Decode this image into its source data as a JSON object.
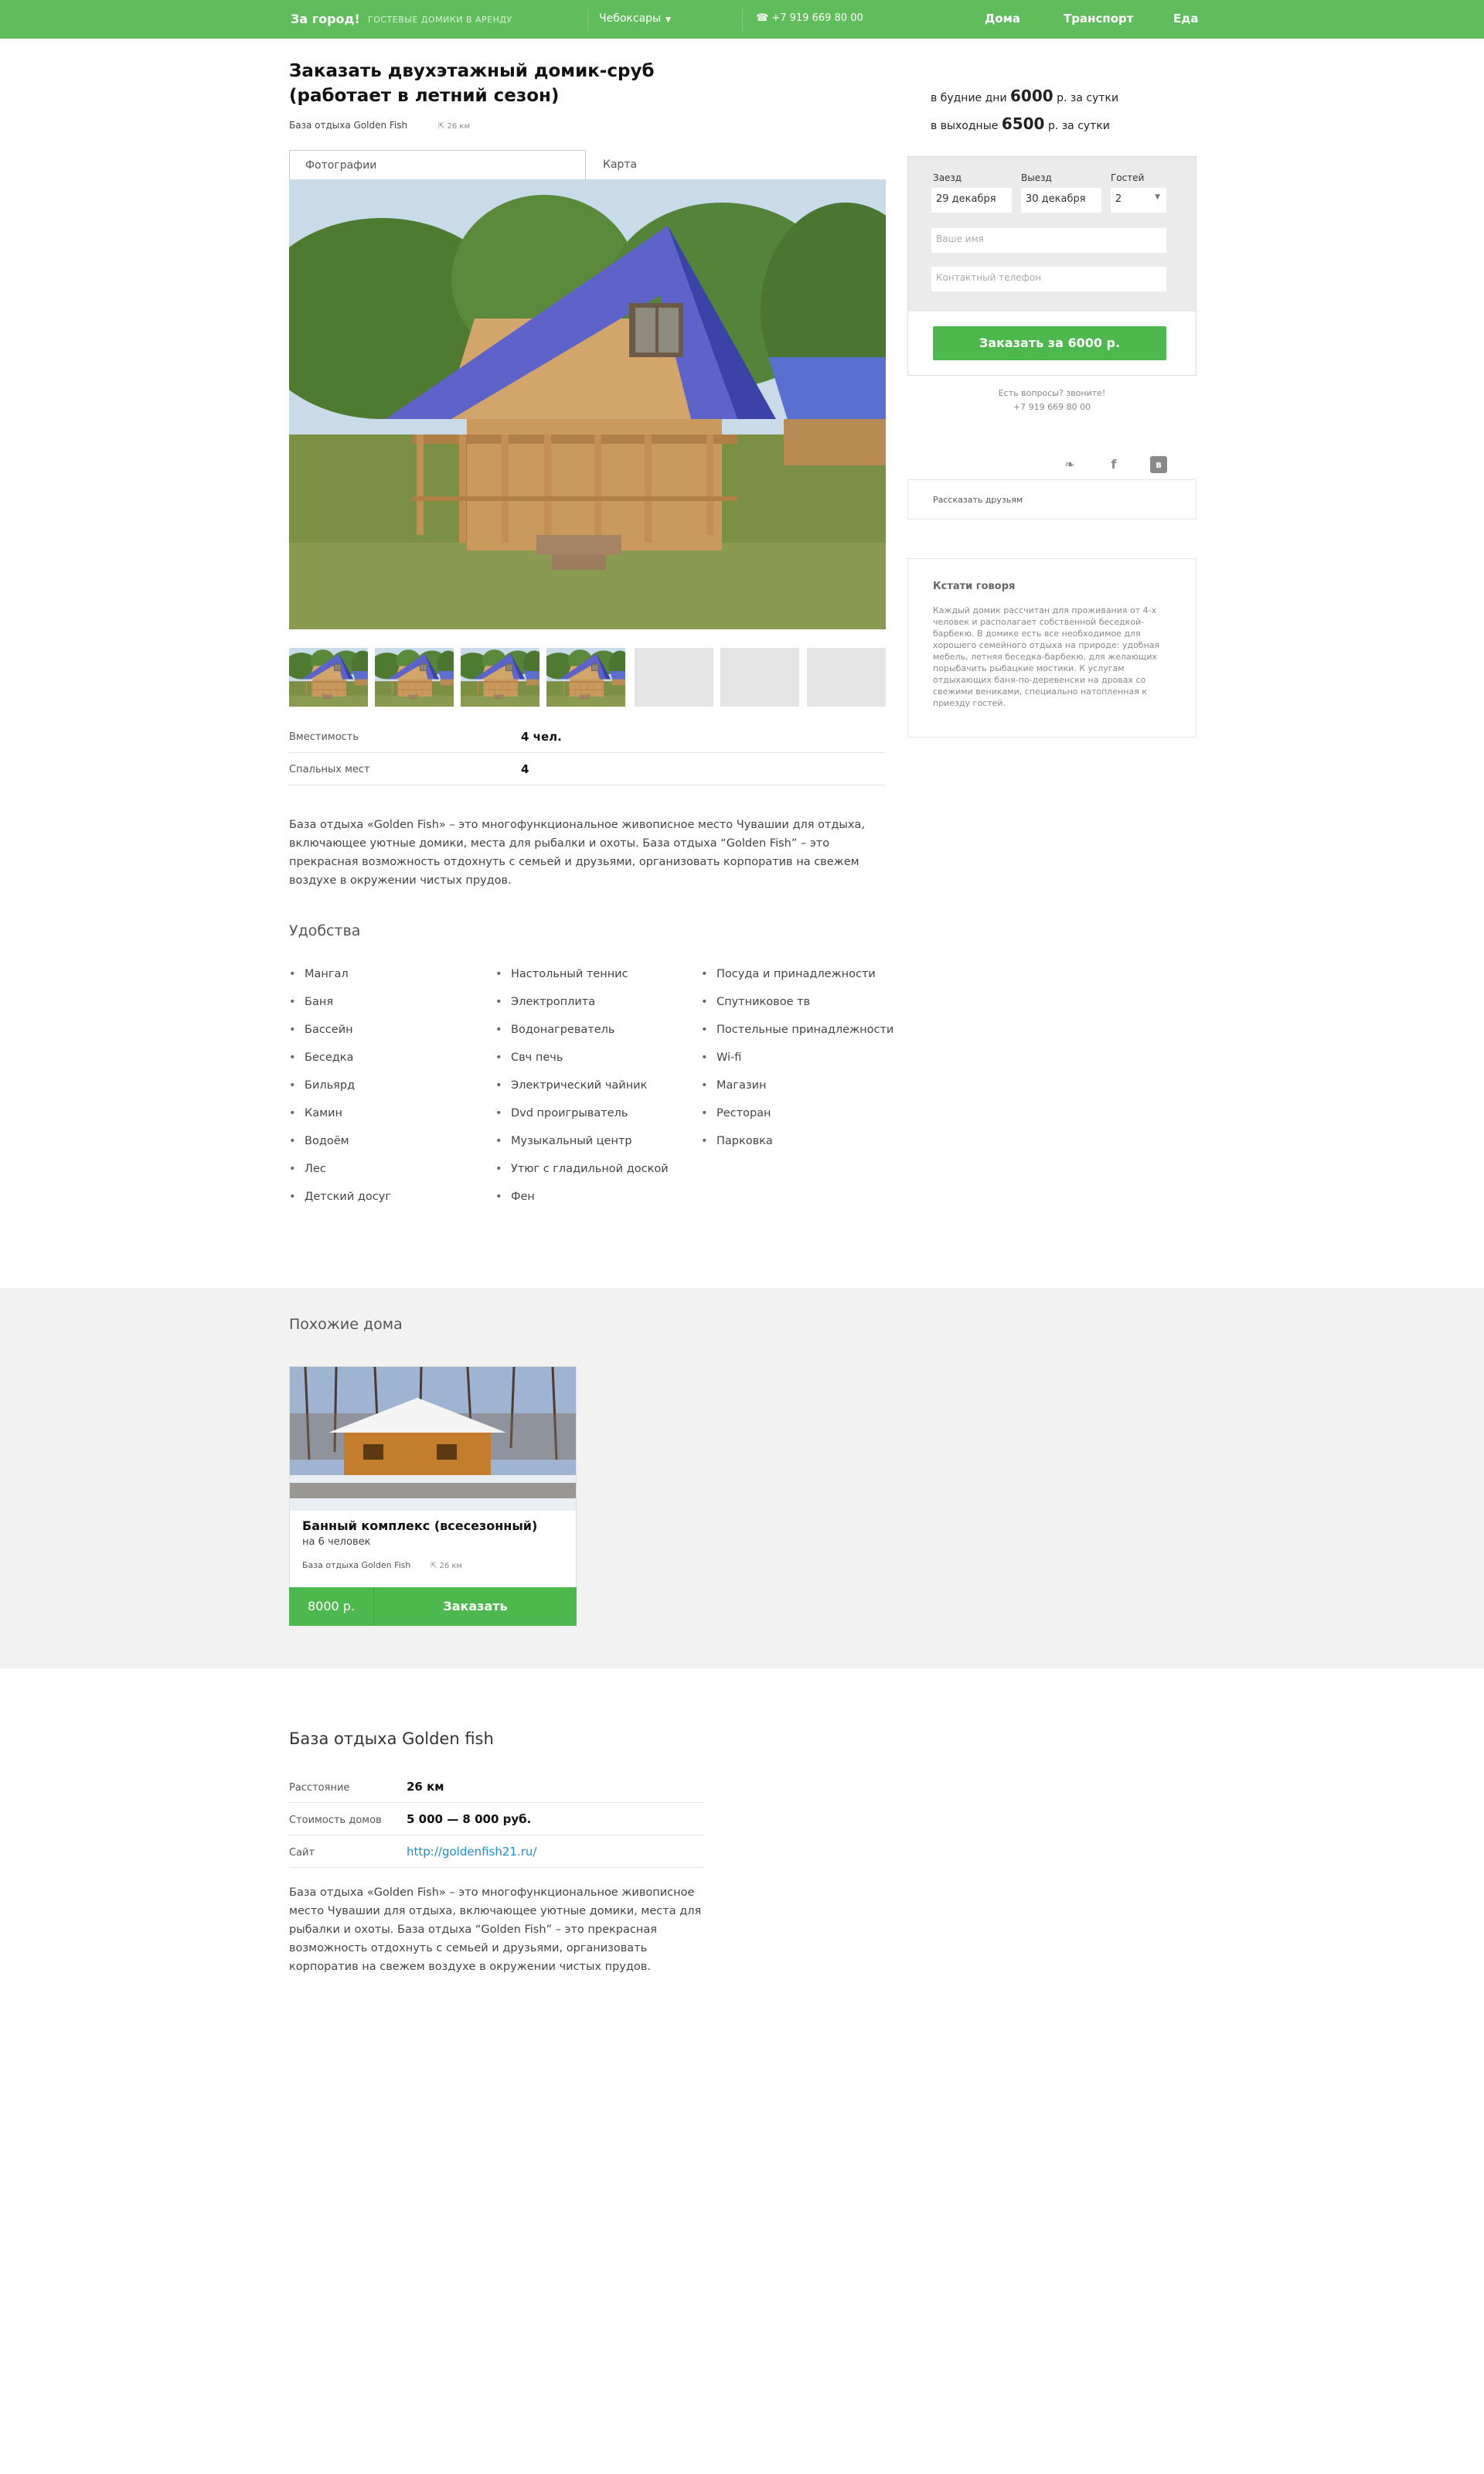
{
  "header": {
    "logo": "За город!",
    "tagline": "ГОСТЕВЫЕ ДОМИКИ В АРЕНДУ",
    "city": "Чебоксары",
    "phone": "+7 919 669 80 00",
    "nav": [
      "Дома",
      "Транспорт",
      "Еда"
    ],
    "accent_color": "#5fbd5b"
  },
  "listing": {
    "title_line1": "Заказать двухэтажный домик-сруб",
    "title_line2": "(работает в летний сезон)",
    "base_name": "База отдыха Golden Fish",
    "distance": "26 км",
    "tabs": [
      "Фотографии",
      "Карта"
    ],
    "specs": [
      {
        "label": "Вместимость",
        "value": "4 чел."
      },
      {
        "label": "Спальных мест",
        "value": "4"
      }
    ],
    "description": "База отдыха «Golden Fish» – это многофункциональное живописное место Чувашии для отдыха, включающее уютные домики, места для рыбалки и охоты. База отдыха “Golden Fish” – это прекрасная возможность отдохнуть с семьей и друзьями, организовать корпоратив на свежем воздухе в окружении чистых прудов."
  },
  "amenities": {
    "title": "Удобства",
    "col1": [
      "Мангал",
      "Баня",
      "Бассейн",
      "Беседка",
      "Бильярд",
      "Камин",
      "Водоём",
      "Лес",
      "Детский досуг"
    ],
    "col2": [
      "Настольный теннис",
      "Электроплита",
      "Водонагреватель",
      "Свч печь",
      "Электрический чайник",
      "Dvd проигрыватель",
      "Музыкальный центр",
      "Утюг с гладильной доской",
      "Фен"
    ],
    "col3": [
      "Посуда и принадлежности",
      "Спутниковое тв",
      "Постельные принадлежности",
      "Wi-fi",
      "Магазин",
      "Ресторан",
      "Парковка"
    ]
  },
  "pricing": {
    "weekday_prefix": "в будние дни",
    "weekday_price": "6000",
    "weekday_suffix": "р. за сутки",
    "weekend_prefix": "в выходные",
    "weekend_price": "6500",
    "weekend_suffix": "р. за сутки"
  },
  "booking": {
    "checkin_label": "Заезд",
    "checkin_value": "29 декабря",
    "checkout_label": "Выезд",
    "checkout_value": "30 декабря",
    "guests_label": "Гостей",
    "guests_value": "2",
    "name_placeholder": "Ваше имя",
    "phone_placeholder": "Контактный телефон",
    "submit_label": "Заказать за 6000 р.",
    "questions_text": "Есть вопросы? звоните!",
    "questions_phone": "+7 919 669 80 00",
    "button_color": "#4db84d"
  },
  "social": {
    "icons": [
      "twitter-icon",
      "facebook-icon",
      "vk-icon"
    ],
    "share_label": "Рассказать друзьям"
  },
  "info": {
    "title": "Кстати говоря",
    "text": "Каждый домик рассчитан для проживания от 4-х человек и располагает собственной беседкой-барбекю. В домике есть все необходимое для хорошего семейного отдыха на природе: удобная мебель, летняя беседка-барбекю, для желающих порыбачить рыбацкие мостики. К услугам отдыхающих баня-по-деревенски на дровах со свежими вениками, специально натопленная к приезду гостей."
  },
  "similar": {
    "title": "Похожие дома",
    "cards": [
      {
        "title": "Банный комплекс (всесезонный)",
        "subtitle": "на 6 человек",
        "base": "База отдыха Golden Fish",
        "distance": "26 км",
        "price": "8000 р.",
        "order_label": "Заказать"
      }
    ]
  },
  "base_info": {
    "title": "База отдыха Golden fish",
    "rows": [
      {
        "label": "Расстояние",
        "value": "26 км"
      },
      {
        "label": "Стоимость домов",
        "value": "5 000 — 8 000 руб."
      },
      {
        "label": "Сайт",
        "value": "http://goldenfish21.ru/"
      }
    ],
    "description": "База отдыха «Golden Fish» – это многофункциональное живописное место Чувашии для отдыха, включающее уютные домики, места для рыбалки и охоты. База отдыха “Golden Fish” – это прекрасная возможность отдохнуть с семьей и друзьями, организовать корпоратив на свежем воздухе в окружении чистых прудов."
  }
}
